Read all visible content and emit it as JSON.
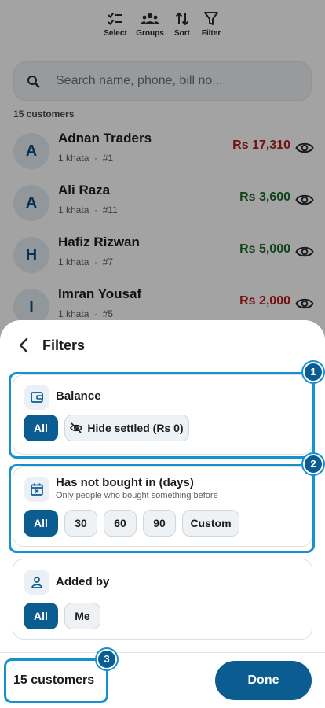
{
  "toolbar": {
    "select": "Select",
    "groups": "Groups",
    "sort": "Sort",
    "filter": "Filter"
  },
  "search": {
    "placeholder": "Search name, phone, bill no..."
  },
  "list": {
    "count_label": "15 customers",
    "customers": [
      {
        "initial": "A",
        "name": "Adnan Traders",
        "khata": "1 khata",
        "number": "#1",
        "amount": "Rs 17,310",
        "amount_color": "#b71c1c"
      },
      {
        "initial": "A",
        "name": "Ali Raza",
        "khata": "1 khata",
        "number": "#11",
        "amount": "Rs 3,600",
        "amount_color": "#1b6b2a"
      },
      {
        "initial": "H",
        "name": "Hafiz Rizwan",
        "khata": "1 khata",
        "number": "#7",
        "amount": "Rs 5,000",
        "amount_color": "#1b6b2a"
      },
      {
        "initial": "I",
        "name": "Imran Yousaf",
        "khata": "1 khata",
        "number": "#5",
        "amount": "Rs 2,000",
        "amount_color": "#b71c1c"
      }
    ],
    "separator": "·"
  },
  "sheet": {
    "title": "Filters",
    "balance": {
      "title": "Balance",
      "options": [
        "All",
        "Hide settled (Rs 0)"
      ],
      "selected": "All"
    },
    "not_bought": {
      "title": "Has not bought in (days)",
      "subtitle": "Only people who bought something before",
      "options": [
        "All",
        "30",
        "60",
        "90",
        "Custom"
      ],
      "selected": "All"
    },
    "added_by": {
      "title": "Added by",
      "options": [
        "All",
        "Me"
      ],
      "selected": "All"
    },
    "footer": {
      "count": "15 customers",
      "done": "Done"
    }
  },
  "highlights": [
    "1",
    "2",
    "3"
  ],
  "colors": {
    "accent": "#0b5c90",
    "highlight": "#1591d0",
    "debit": "#b71c1c",
    "credit": "#1b6b2a"
  }
}
